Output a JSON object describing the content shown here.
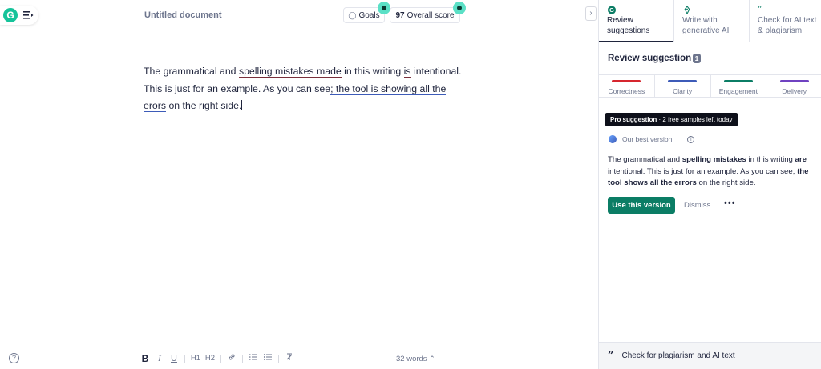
{
  "editor": {
    "doc_title": "Untitled document",
    "goals_label": "Goals",
    "score_value": "97",
    "score_label": "Overall score",
    "lines": [
      [
        "The grammatical and ",
        "spelling mistakes made",
        " in this writing ",
        "is",
        " intentional."
      ],
      [
        "This is just for an example. As you can see",
        "; the tool is showing all the",
        ""
      ],
      [
        "erors",
        " on the right side."
      ]
    ],
    "word_count": "32 words",
    "toolbar": {
      "bold": "B",
      "italic": "I",
      "underline": "U",
      "h1": "H1",
      "h2": "H2"
    }
  },
  "panel": {
    "tabs": [
      {
        "label": "Review suggestions",
        "icon": "grammarly-g-icon"
      },
      {
        "label": "Write with generative AI",
        "icon": "pen-nib-icon"
      },
      {
        "label": "Check for AI text & plagiarism",
        "icon": "quote-icon"
      }
    ],
    "review_title": "Review suggestion",
    "review_count": "1",
    "categories": [
      {
        "label": "Correctness",
        "color": "#d6262e"
      },
      {
        "label": "Clarity",
        "color": "#3d5bb8"
      },
      {
        "label": "Engagement",
        "color": "#0b7d65"
      },
      {
        "label": "Delivery",
        "color": "#6f42c1"
      }
    ],
    "pro_badge_bold": "Pro suggestion",
    "pro_badge_rest": " · 2 free samples left today",
    "best_version_label": "Our best version",
    "suggestion_parts": [
      {
        "text": "The grammatical and ",
        "bold": false
      },
      {
        "text": "spelling mistakes",
        "bold": true
      },
      {
        "text": " in this writing ",
        "bold": false
      },
      {
        "text": "are",
        "bold": true
      },
      {
        "text": " intentional. This is just for an example. As you can see, ",
        "bold": false
      },
      {
        "text": "the tool shows all the errors",
        "bold": true
      },
      {
        "text": " on the right side.",
        "bold": false
      }
    ],
    "use_button": "Use this version",
    "dismiss": "Dismiss",
    "more": "•••",
    "plagiarism_bar": "Check for plagiarism and AI text"
  }
}
